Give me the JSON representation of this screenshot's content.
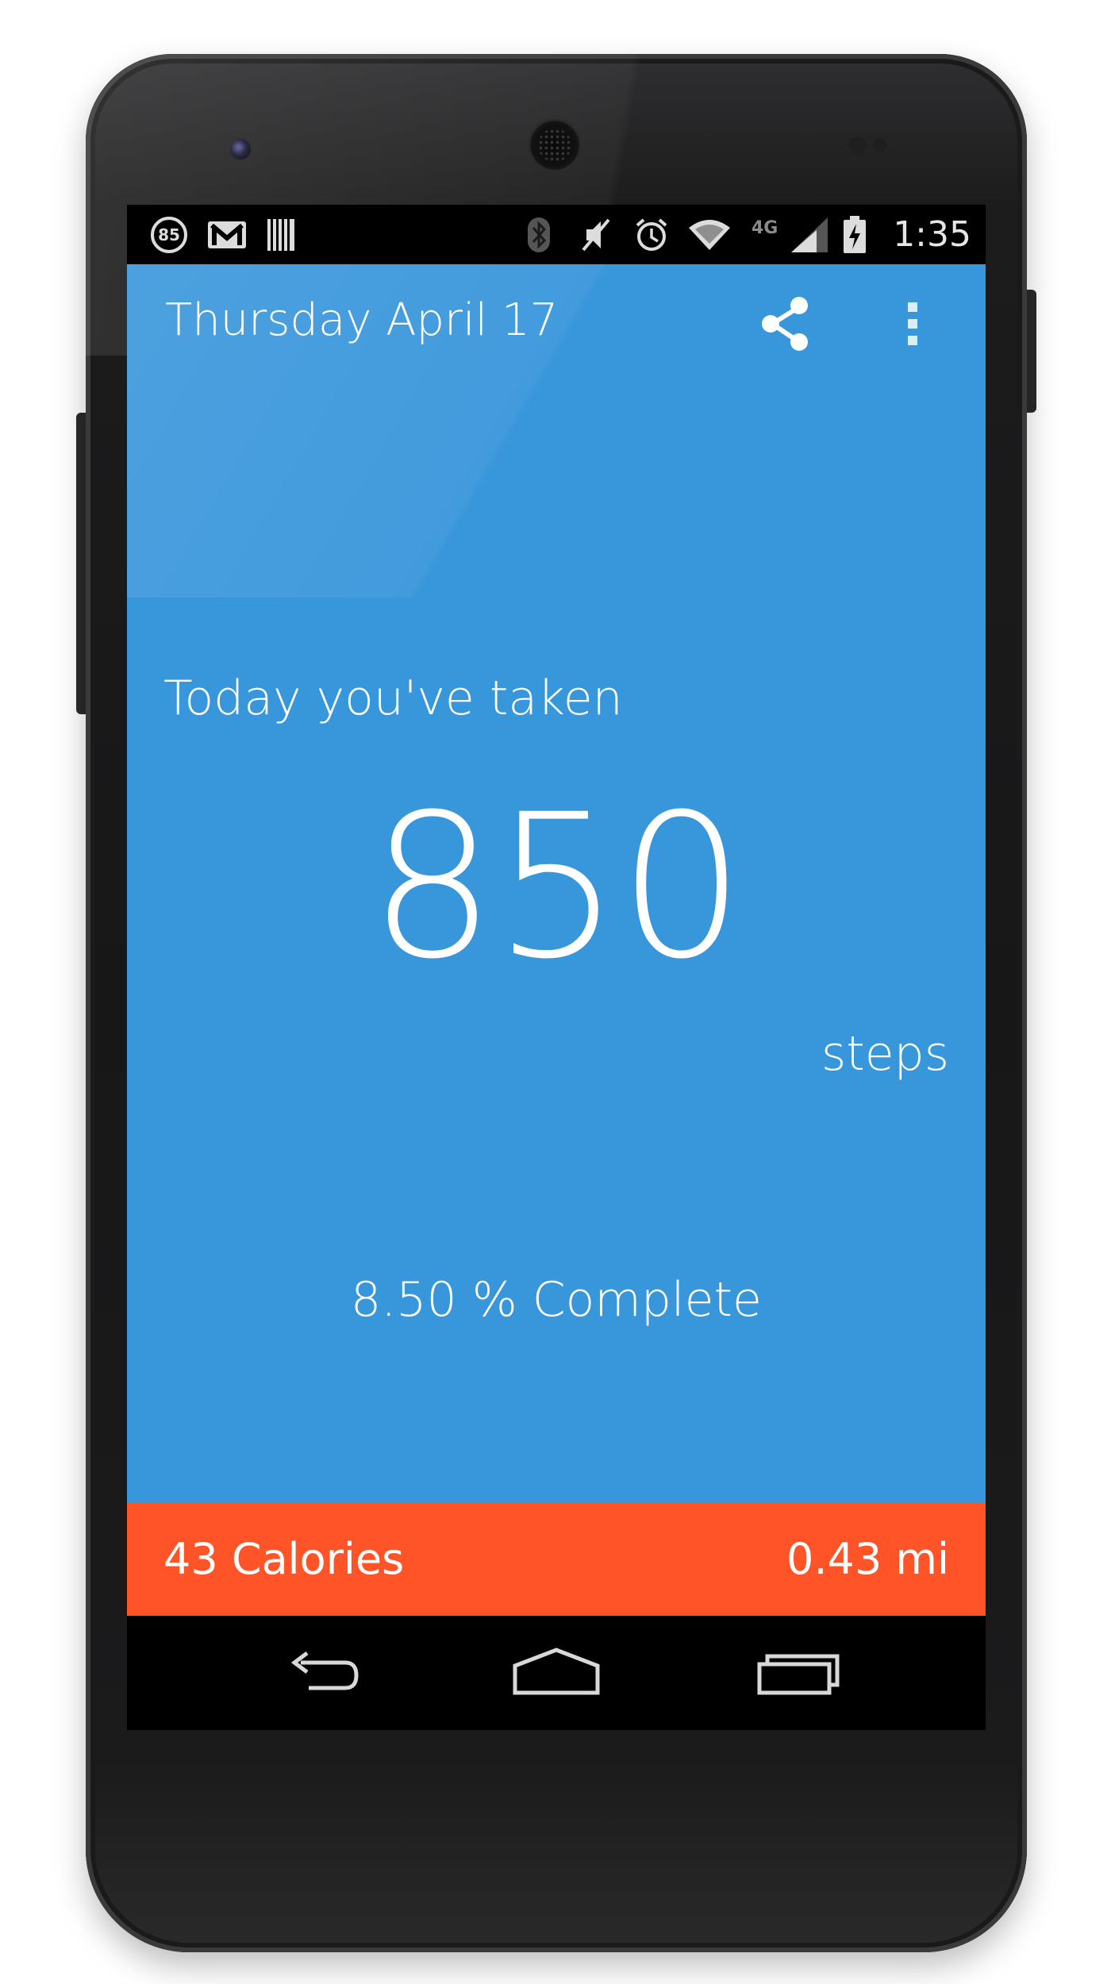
{
  "status_bar": {
    "time": "1:35",
    "notification_icons": [
      "speed-limit-85-icon",
      "gmail-icon",
      "barcode-icon"
    ],
    "system_icons": [
      "bluetooth-icon",
      "vibrate-off-icon",
      "alarm-icon",
      "wifi-icon",
      "lte-signal-icon",
      "battery-charging-icon"
    ],
    "speed_badge": "85",
    "network_label": "4G"
  },
  "action_bar": {
    "title": "Thursday April 17",
    "actions": [
      "share-icon",
      "overflow-menu-icon"
    ]
  },
  "main": {
    "intro": "Today you've taken",
    "step_count": "850",
    "steps_unit": "steps",
    "progress_text": "8.50 % Complete",
    "progress_fraction": 0.085
  },
  "stats": {
    "calories": "43 Calories",
    "distance": "0.43 mi"
  },
  "nav_bar": {
    "buttons": [
      "back-icon",
      "home-icon",
      "recent-apps-icon"
    ]
  },
  "colors": {
    "app_background": "#3896db",
    "stats_background": "#ff5428",
    "text": "#ffffff",
    "phone_body": "#1a1a1b"
  }
}
